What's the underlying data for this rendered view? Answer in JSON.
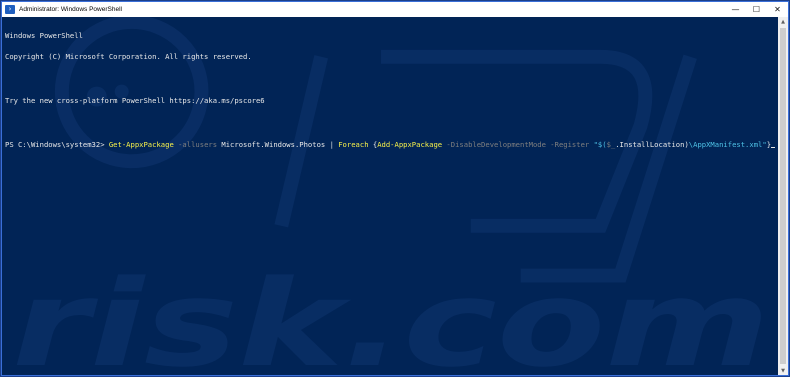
{
  "window": {
    "title": "Administrator: Windows PowerShell",
    "controls": {
      "minimize": "—",
      "maximize": "☐",
      "close": "✕"
    },
    "icon_name": "powershell-icon"
  },
  "console": {
    "line1": "Windows PowerShell",
    "line2": "Copyright (C) Microsoft Corporation. All rights reserved.",
    "line4": "Try the new cross-platform PowerShell https://aka.ms/pscore6",
    "prompt": "PS C:\\Windows\\system32> ",
    "cmd1": "Get-AppxPackage",
    "param1": " -allusers",
    "arg1": " Microsoft.Windows.Photos | ",
    "cmd2": "Foreach",
    "brace_open": " {",
    "cmd3": "Add-AppxPackage",
    "param2": " -DisableDevelopmentMode -Register ",
    "str_open": "\"$(",
    "var": "$_",
    "prop": ".InstallLocation)",
    "str_path": "\\AppXManifest.xml\"",
    "brace_close": "}"
  },
  "watermark": {
    "text": "risk.com"
  },
  "colors": {
    "background": "#012456",
    "cmdlet": "#f7f14a",
    "parameter": "#7f7f7f",
    "string": "#4ec2e6",
    "text": "#e8e8e8"
  }
}
